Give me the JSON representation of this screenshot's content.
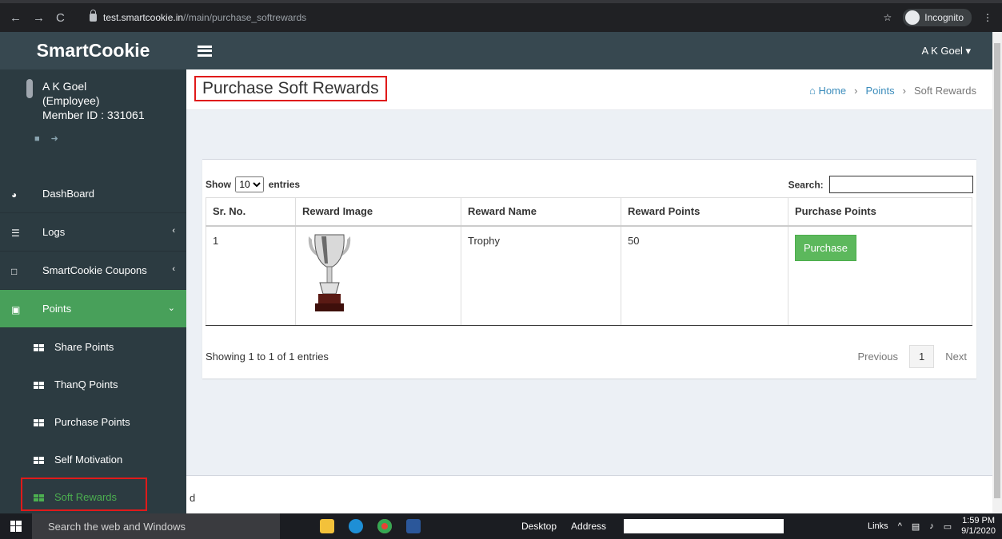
{
  "browser": {
    "url_host": "test.smartcookie.in",
    "url_path": "//main/purchase_softrewards",
    "incognito_label": "Incognito"
  },
  "sidebar": {
    "brand": "SmartCookie",
    "user_name": "A K Goel",
    "user_role": "(Employee)",
    "member_id": "Member ID : 331061",
    "items": [
      {
        "label": "DashBoard",
        "icon": "dashboard-icon"
      },
      {
        "label": "Logs",
        "icon": "list-icon",
        "caret": "‹"
      },
      {
        "label": "SmartCookie Coupons",
        "icon": "file-icon",
        "caret": "‹"
      },
      {
        "label": "Points",
        "icon": "briefcase-icon",
        "caret": "⌄"
      }
    ],
    "sub_items": [
      {
        "label": "Share Points"
      },
      {
        "label": "ThanQ Points"
      },
      {
        "label": "Purchase Points"
      },
      {
        "label": "Self Motivation"
      },
      {
        "label": "Soft Rewards"
      }
    ]
  },
  "topbar": {
    "user_menu": "A K Goel ▾"
  },
  "header": {
    "title": "Purchase Soft Rewards",
    "breadcrumb": [
      "Home",
      "Points",
      "Soft Rewards"
    ],
    "separator": "›"
  },
  "table": {
    "show_label": "Show",
    "entries_value": "10",
    "entries_label": "entries",
    "search_label": "Search:",
    "columns": [
      "Sr. No.",
      "Reward Image",
      "Reward Name",
      "Reward Points",
      "Purchase Points"
    ],
    "rows": [
      {
        "sr": "1",
        "image": "trophy-image",
        "name": "Trophy",
        "points": "50",
        "action": "Purchase"
      }
    ],
    "info": "Showing 1 to 1 of 1 entries",
    "prev": "Previous",
    "page": "1",
    "next": "Next"
  },
  "footer_fragment": "d",
  "taskbar": {
    "search_placeholder": "Search the web and Windows",
    "desktop_label": "Desktop",
    "address_label": "Address",
    "links_label": "Links",
    "time": "1:59 PM",
    "date": "9/1/2020"
  },
  "colors": {
    "sidebar_bg": "#2c3b41",
    "active_green": "#48a05a",
    "highlight_red": "#e01a1a",
    "button_green": "#5cb85c",
    "link_blue": "#3c8dbc"
  }
}
